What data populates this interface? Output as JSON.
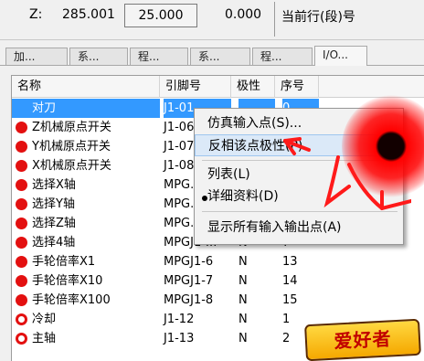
{
  "status": {
    "z_label": "Z:",
    "z_value": "285.001",
    "box_value": "25.000",
    "value2": "0.000",
    "current_line_label": "当前行(段)号"
  },
  "tabs": [
    "加...",
    "系...",
    "程...",
    "系...",
    "程...",
    "I/O..."
  ],
  "list": {
    "columns": [
      "名称",
      "引脚号",
      "极性",
      "序号"
    ],
    "rows": [
      {
        "name": "对刀",
        "pin": "J1-01",
        "polarity": "",
        "seq": "0",
        "icon": "gray-dot",
        "selected": true
      },
      {
        "name": "Z机械原点开关",
        "pin": "J1-06",
        "polarity": "",
        "seq": "",
        "icon": "red-dot"
      },
      {
        "name": "Y机械原点开关",
        "pin": "J1-07",
        "polarity": "",
        "seq": "",
        "icon": "red-dot"
      },
      {
        "name": "X机械原点开关",
        "pin": "J1-08",
        "polarity": "",
        "seq": "",
        "icon": "red-dot"
      },
      {
        "name": "选择X轴",
        "pin": "MPG.",
        "polarity": "",
        "seq": "",
        "icon": "red-dot"
      },
      {
        "name": "选择Y轴",
        "pin": "MPG.",
        "polarity": "",
        "seq": "",
        "icon": "red-dot"
      },
      {
        "name": "选择Z轴",
        "pin": "MPG.",
        "polarity": "",
        "seq": "",
        "icon": "red-dot"
      },
      {
        "name": "选择4轴",
        "pin": "MPGJ1-...",
        "polarity": "N",
        "seq": "7",
        "icon": "red-dot"
      },
      {
        "name": "手轮倍率X1",
        "pin": "MPGJ1-6",
        "polarity": "N",
        "seq": "13",
        "icon": "red-dot"
      },
      {
        "name": "手轮倍率X10",
        "pin": "MPGJ1-7",
        "polarity": "N",
        "seq": "14",
        "icon": "red-dot"
      },
      {
        "name": "手轮倍率X100",
        "pin": "MPGJ1-8",
        "polarity": "N",
        "seq": "15",
        "icon": "red-dot"
      },
      {
        "name": "冷却",
        "pin": "J1-12",
        "polarity": "N",
        "seq": "1",
        "icon": "red-ring"
      },
      {
        "name": "主轴",
        "pin": "J1-13",
        "polarity": "N",
        "seq": "2",
        "icon": "red-ring"
      }
    ]
  },
  "context_menu": {
    "items": [
      {
        "label": "仿真输入点(S)..."
      },
      {
        "label": "反相该点极性(P)",
        "highlighted": true
      },
      {
        "label": "列表(L)"
      },
      {
        "label": "详细资料(D)",
        "checked": true
      },
      {
        "label": "显示所有输入输出点(A)"
      }
    ]
  },
  "watermark": {
    "text": "爱好者"
  }
}
